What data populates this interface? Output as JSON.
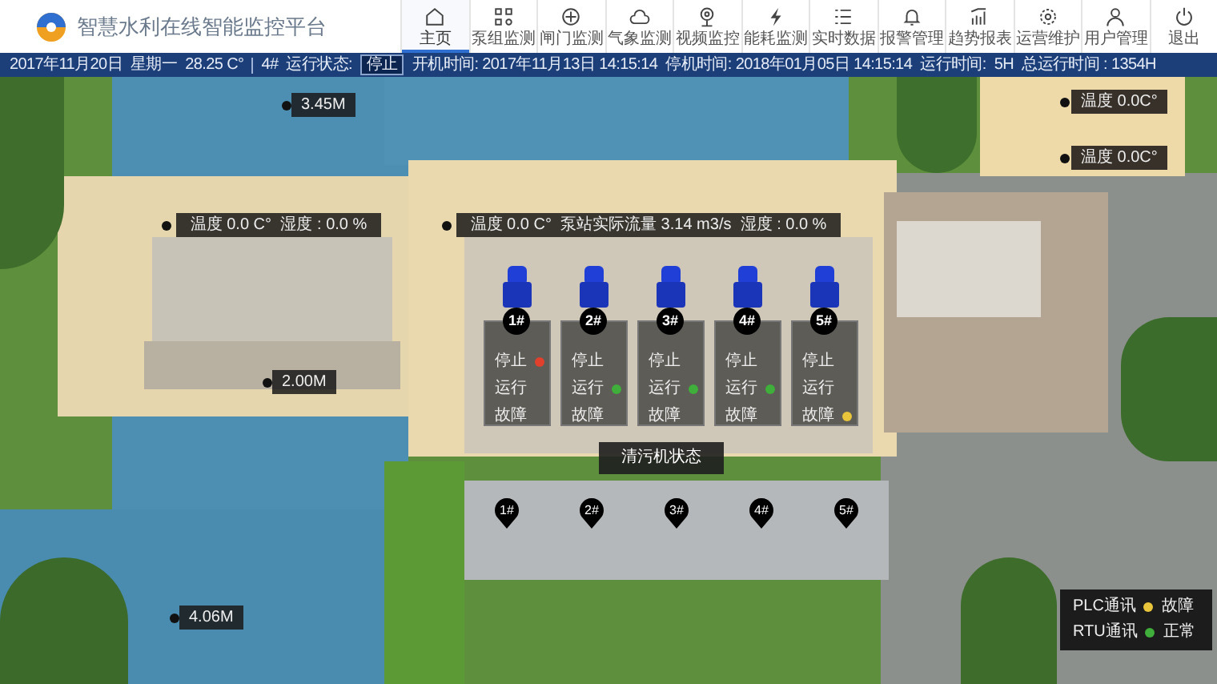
{
  "header": {
    "title": "智慧水利在线智能监控平台",
    "nav": [
      {
        "label": "主页",
        "selected": true
      },
      {
        "label": "泵组监测",
        "selected": false
      },
      {
        "label": "闸门监测",
        "selected": false
      },
      {
        "label": "气象监测",
        "selected": false
      },
      {
        "label": "视频监控",
        "selected": false
      },
      {
        "label": "能耗监测",
        "selected": false
      },
      {
        "label": "实时数据",
        "selected": false
      },
      {
        "label": "报警管理",
        "selected": false
      },
      {
        "label": "趋势报表",
        "selected": false
      },
      {
        "label": "运营维护",
        "selected": false
      },
      {
        "label": "用户管理",
        "selected": false
      },
      {
        "label": "退出",
        "selected": false
      }
    ]
  },
  "status_bar": {
    "date": "2017年11月20日",
    "weekday": "星期一",
    "temperature": "28.25 C°",
    "unit": "4#",
    "run_state_label": "运行状态:",
    "run_state": "停止",
    "start_time": "开机时间: 2017年11月13日 14:15:14",
    "stop_time": "停机时间: 2018年01月05日 14:15:14",
    "run_time_label": "运行时间:",
    "run_time": "5H",
    "total_run_time": "总运行时间 : 1354H"
  },
  "scene": {
    "water_levels": [
      "3.45M",
      "2.00M",
      "4.06M"
    ],
    "left_panel": {
      "temperature": "温度  0.0  C°",
      "humidity": "湿度 : 0.0  %"
    },
    "center_panel": {
      "temperature": "温度  0.0  C°",
      "flow": "泵站实际流量  3.14  m3/s",
      "humidity": "湿度 : 0.0  %"
    },
    "right_labels": [
      "温度   0.0C°",
      "温度   0.0C°"
    ],
    "pumps": [
      {
        "label": "1#",
        "color": "#e0402c",
        "rows": [
          {
            "text": "停止",
            "on": true
          },
          {
            "text": "运行",
            "on": false
          },
          {
            "text": "故障",
            "on": false
          }
        ]
      },
      {
        "label": "2#",
        "color": "#3fae3a",
        "rows": [
          {
            "text": "停止",
            "on": false
          },
          {
            "text": "运行",
            "on": true
          },
          {
            "text": "故障",
            "on": false
          }
        ]
      },
      {
        "label": "3#",
        "color": "#3fae3a",
        "rows": [
          {
            "text": "停止",
            "on": false
          },
          {
            "text": "运行",
            "on": true
          },
          {
            "text": "故障",
            "on": false
          }
        ]
      },
      {
        "label": "4#",
        "color": "#3fae3a",
        "rows": [
          {
            "text": "停止",
            "on": false
          },
          {
            "text": "运行",
            "on": true
          },
          {
            "text": "故障",
            "on": false
          }
        ]
      },
      {
        "label": "5#",
        "color": "#e8c53a",
        "rows": [
          {
            "text": "停止",
            "on": false
          },
          {
            "text": "运行",
            "on": false
          },
          {
            "text": "故障",
            "on": true
          }
        ]
      }
    ],
    "cleaner_status": "清污机状态",
    "gates": [
      "1#",
      "2#",
      "3#",
      "4#",
      "5#"
    ],
    "legend": [
      {
        "label": "PLC通讯",
        "status": "故障",
        "color": "#e8c53a"
      },
      {
        "label": "RTU通讯",
        "status": "正常",
        "color": "#3fae3a"
      }
    ]
  }
}
